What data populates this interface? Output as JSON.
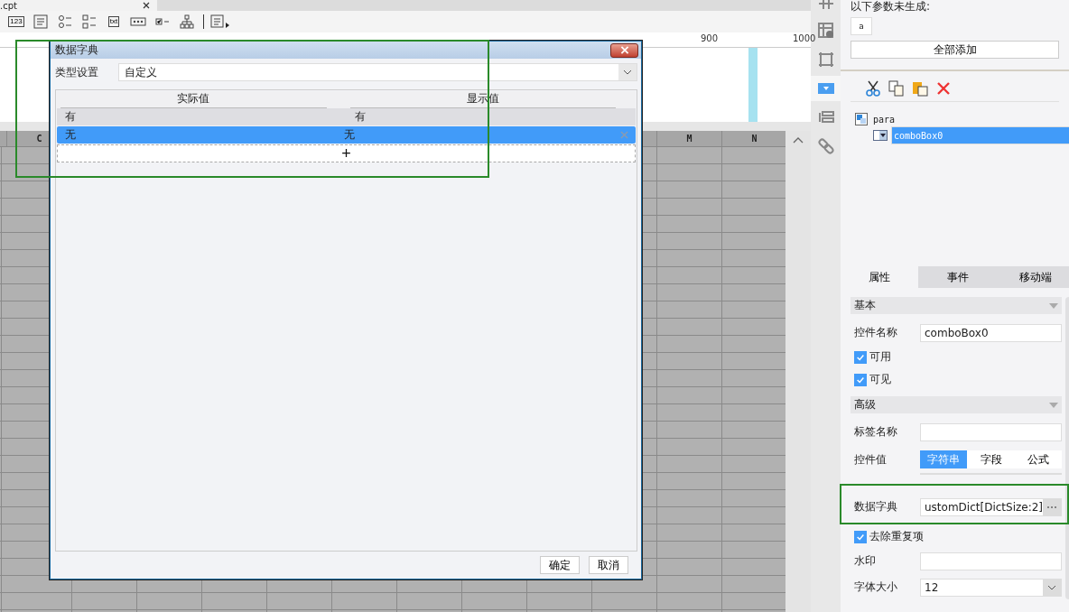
{
  "document_tab": {
    "label": ".cpt"
  },
  "toolbar": [
    {
      "kind": "number",
      "label": "123"
    },
    {
      "kind": "textarea"
    },
    {
      "kind": "radio"
    },
    {
      "kind": "checkbox"
    },
    {
      "kind": "text",
      "label": "txt"
    },
    {
      "kind": "password"
    },
    {
      "kind": "check"
    },
    {
      "kind": "tree"
    },
    {
      "kind": "more"
    }
  ],
  "ruler": {
    "labels": [
      "900",
      "1000"
    ]
  },
  "sheet": {
    "column_headers": [
      "C",
      "M",
      "N"
    ]
  },
  "dialog": {
    "title": "数据字典",
    "type_label": "类型设置",
    "type_value": "自定义",
    "columns": [
      "实际值",
      "显示值"
    ],
    "rows": [
      {
        "actual": "有",
        "display": "有",
        "selected": false
      },
      {
        "actual": "无",
        "display": "无",
        "selected": true
      }
    ],
    "add_symbol": "+",
    "buttons": [
      "确定",
      "取消"
    ]
  },
  "rail": [
    {
      "kind": "grid",
      "selected": false
    },
    {
      "kind": "info",
      "selected": false
    },
    {
      "kind": "frame",
      "selected": false
    },
    {
      "kind": "dropdown",
      "selected": true
    },
    {
      "kind": "list",
      "selected": false
    },
    {
      "kind": "link",
      "selected": false
    }
  ],
  "params": {
    "title": "以下参数未生成:",
    "chips": [
      "a"
    ],
    "add_all": "全部添加"
  },
  "widget_tree": [
    {
      "label": "para",
      "selected": false,
      "children": [
        {
          "label": "comboBox0",
          "selected": true
        }
      ]
    }
  ],
  "property_tabs": [
    {
      "label": "属性",
      "selected": true
    },
    {
      "label": "事件",
      "selected": false
    },
    {
      "label": "移动端",
      "selected": false
    }
  ],
  "sections": [
    {
      "title": "基本",
      "rows": [
        {
          "kind": "text",
          "label": "控件名称",
          "value": "comboBox0"
        },
        {
          "kind": "check",
          "label": "可用",
          "checked": true
        },
        {
          "kind": "check",
          "label": "可见",
          "checked": true
        }
      ]
    },
    {
      "title": "高级",
      "rows": [
        {
          "kind": "text",
          "label": "标签名称"
        },
        {
          "kind": "segmented",
          "label": "控件值",
          "options": [
            {
              "label": "字符串",
              "selected": true
            },
            {
              "label": "字段",
              "selected": false
            },
            {
              "label": "公式",
              "selected": false
            }
          ]
        },
        {
          "kind": "dict",
          "label": "数据字典",
          "value": "ustomDict[DictSize:2]"
        },
        {
          "kind": "check",
          "label": "去除重复项",
          "checked": true
        },
        {
          "kind": "text",
          "label": "水印"
        },
        {
          "kind": "select",
          "label": "字体大小",
          "value": "12"
        }
      ]
    }
  ]
}
